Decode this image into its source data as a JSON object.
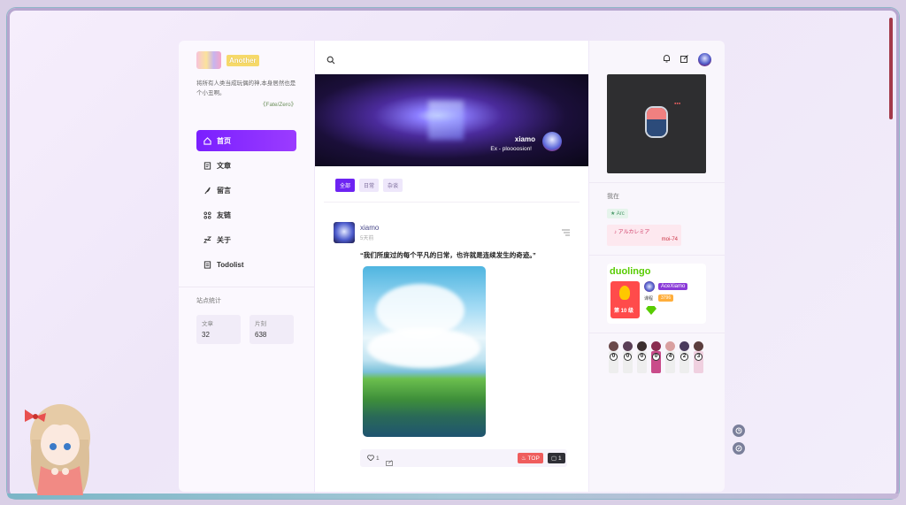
{
  "sidebar": {
    "logo_tag": "Another",
    "quote": "将所有人类当成玩偶的神,本身居然也是个小丑啊。",
    "quote_source": "《Fate/Zero》",
    "nav": [
      {
        "label": "首页",
        "icon": "home-icon",
        "active": true
      },
      {
        "label": "文章",
        "icon": "article-icon",
        "active": false
      },
      {
        "label": "留言",
        "icon": "feather-icon",
        "active": false
      },
      {
        "label": "友链",
        "icon": "link-icon",
        "active": false
      },
      {
        "label": "关于",
        "icon": "sleep-icon",
        "active": false
      },
      {
        "label": "Todolist",
        "icon": "todo-icon",
        "active": false
      }
    ],
    "stats_title": "站点统计",
    "stats": [
      {
        "key": "文章",
        "value": "32"
      },
      {
        "key": "片刻",
        "value": "638"
      }
    ]
  },
  "main": {
    "banner": {
      "name": "xiamo",
      "subtitle": "Ex - ploooosion!"
    },
    "tabs": [
      {
        "label": "全部",
        "active": true
      },
      {
        "label": "日常",
        "active": false
      },
      {
        "label": "杂谈",
        "active": false
      }
    ],
    "post": {
      "author": "xiamo",
      "time": "5天前",
      "text": "“我们所度过的每个平凡的日常，也许就是连续发生的奇迹。”",
      "likes": "1",
      "top_label": "TOP",
      "comments": "1"
    }
  },
  "right": {
    "listening_title": "我在",
    "arc_chip": "Arc",
    "song_title": "アルカレミア",
    "song_artist": "moi-74",
    "duolingo": {
      "logo": "duolingo",
      "username": "AceXiamo",
      "level": "第 10 级",
      "label": "课程",
      "xp": "3796"
    },
    "counter_digits": [
      "0",
      "0",
      "0",
      "0",
      "4",
      "2",
      "3"
    ]
  },
  "colors": {
    "accent": "#7a1fff",
    "top_badge": "#ef5d5d",
    "duolingo_green": "#58cc02"
  }
}
